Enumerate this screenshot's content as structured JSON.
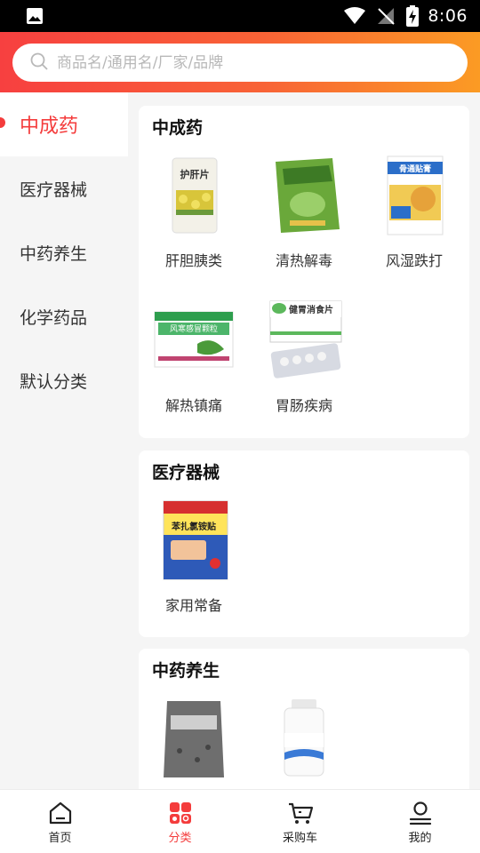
{
  "status_bar": {
    "time": "8:06"
  },
  "search": {
    "placeholder": "商品名/通用名/厂家/品牌"
  },
  "categories": [
    {
      "label": "中成药",
      "active": true
    },
    {
      "label": "医疗器械",
      "active": false
    },
    {
      "label": "中药养生",
      "active": false
    },
    {
      "label": "化学药品",
      "active": false
    },
    {
      "label": "默认分类",
      "active": false
    }
  ],
  "sections": [
    {
      "title": "中成药",
      "items": [
        {
          "label": "肝胆胰类",
          "thumb_text": "护肝片"
        },
        {
          "label": "清热解毒",
          "thumb_text": ""
        },
        {
          "label": "风湿跌打",
          "thumb_text": "骨通贴膏"
        },
        {
          "label": "解热镇痛",
          "thumb_text": "风寒感冒颗粒"
        },
        {
          "label": "胃肠疾病",
          "thumb_text": "健胃消食片"
        }
      ]
    },
    {
      "title": "医疗器械",
      "items": [
        {
          "label": "家用常备",
          "thumb_text": "苯扎氯铵贴"
        }
      ]
    },
    {
      "title": "中药养生",
      "items": [
        {
          "label": "",
          "thumb_text": ""
        },
        {
          "label": "",
          "thumb_text": ""
        }
      ]
    }
  ],
  "bottom_nav": [
    {
      "label": "首页",
      "icon": "home-icon",
      "active": false
    },
    {
      "label": "分类",
      "icon": "category-icon",
      "active": true
    },
    {
      "label": "采购车",
      "icon": "cart-icon",
      "active": false
    },
    {
      "label": "我的",
      "icon": "profile-icon",
      "active": false
    }
  ],
  "colors": {
    "accent": "#f43c3c",
    "header_start": "#f74040",
    "header_end": "#fb9b24"
  }
}
